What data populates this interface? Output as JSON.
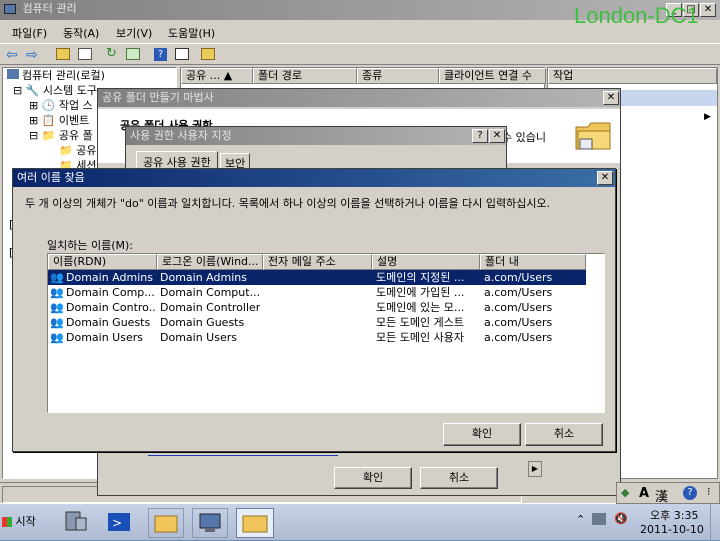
{
  "desktop": {
    "watermark": "London-DC1"
  },
  "main_window": {
    "title": "컴퓨터 관리",
    "menu": [
      "파일(F)",
      "동작(A)",
      "보기(V)",
      "도움말(H)"
    ],
    "tree": [
      {
        "label": "컴퓨터 관리(로컬)"
      },
      {
        "label": "시스템 도구"
      },
      {
        "label": "작업 스"
      },
      {
        "label": "이벤트"
      },
      {
        "label": "공유 폴"
      },
      {
        "label": "공유"
      },
      {
        "label": "세션"
      }
    ],
    "list_columns": [
      "공유 ...",
      "폴더 경로",
      "종류",
      "클라이언트 연결 수"
    ],
    "actions_header": "작업"
  },
  "wizard": {
    "title": "공유 폴더 만들기 마법사",
    "heading": "공유 폴더 사용 권한",
    "side_text": "수 있습니",
    "ok": "확인",
    "cancel": "취소"
  },
  "perm_dialog": {
    "title": "사용 권한 사용자 지정",
    "help": "?",
    "tabs": [
      "공유 사용 권한",
      "보안"
    ]
  },
  "multi_dialog": {
    "title": "여러 이름 찾음",
    "message": "두 개 이상의 개체가 \"do\" 이름과 일치합니다. 목록에서 하나 이상의 이름을 선택하거나 이름을 다시 입력하십시오.",
    "list_label": "일치하는 이름(M):",
    "columns": [
      "이름(RDN)",
      "로그온 이름(Wind...",
      "전자 메일 주소",
      "설명",
      "폴더 내"
    ],
    "rows": [
      {
        "name": "Domain Admins",
        "logon": "Domain Admins",
        "email": "",
        "desc": "도메인의 지정된 ...",
        "folder": "a.com/Users",
        "selected": true
      },
      {
        "name": "Domain Comp...",
        "logon": "Domain Comput...",
        "email": "",
        "desc": "도메인에 가입된 ...",
        "folder": "a.com/Users",
        "selected": false
      },
      {
        "name": "Domain Contro...",
        "logon": "Domain Controllers",
        "email": "",
        "desc": "도메인에 있는 모...",
        "folder": "a.com/Users",
        "selected": false
      },
      {
        "name": "Domain Guests",
        "logon": "Domain Guests",
        "email": "",
        "desc": "모든 도메인 게스트",
        "folder": "a.com/Users",
        "selected": false
      },
      {
        "name": "Domain Users",
        "logon": "Domain Users",
        "email": "",
        "desc": "모든 도메인 사용자",
        "folder": "a.com/Users",
        "selected": false
      }
    ],
    "ok": "확인",
    "cancel": "취소"
  },
  "taskbar": {
    "start": "시작",
    "time": "오후 3:35",
    "date": "2011-10-10",
    "lang_a": "A",
    "lang_han": "漢"
  }
}
